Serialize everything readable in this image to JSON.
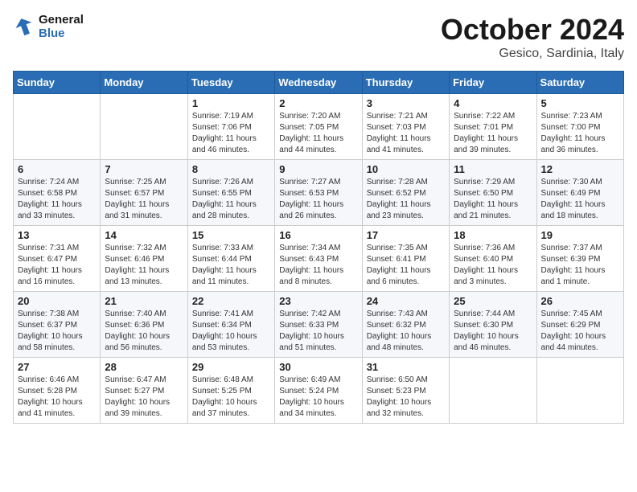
{
  "header": {
    "logo_line1": "General",
    "logo_line2": "Blue",
    "month": "October 2024",
    "location": "Gesico, Sardinia, Italy"
  },
  "weekdays": [
    "Sunday",
    "Monday",
    "Tuesday",
    "Wednesday",
    "Thursday",
    "Friday",
    "Saturday"
  ],
  "weeks": [
    [
      {
        "day": "",
        "info": ""
      },
      {
        "day": "",
        "info": ""
      },
      {
        "day": "1",
        "info": "Sunrise: 7:19 AM\nSunset: 7:06 PM\nDaylight: 11 hours and 46 minutes."
      },
      {
        "day": "2",
        "info": "Sunrise: 7:20 AM\nSunset: 7:05 PM\nDaylight: 11 hours and 44 minutes."
      },
      {
        "day": "3",
        "info": "Sunrise: 7:21 AM\nSunset: 7:03 PM\nDaylight: 11 hours and 41 minutes."
      },
      {
        "day": "4",
        "info": "Sunrise: 7:22 AM\nSunset: 7:01 PM\nDaylight: 11 hours and 39 minutes."
      },
      {
        "day": "5",
        "info": "Sunrise: 7:23 AM\nSunset: 7:00 PM\nDaylight: 11 hours and 36 minutes."
      }
    ],
    [
      {
        "day": "6",
        "info": "Sunrise: 7:24 AM\nSunset: 6:58 PM\nDaylight: 11 hours and 33 minutes."
      },
      {
        "day": "7",
        "info": "Sunrise: 7:25 AM\nSunset: 6:57 PM\nDaylight: 11 hours and 31 minutes."
      },
      {
        "day": "8",
        "info": "Sunrise: 7:26 AM\nSunset: 6:55 PM\nDaylight: 11 hours and 28 minutes."
      },
      {
        "day": "9",
        "info": "Sunrise: 7:27 AM\nSunset: 6:53 PM\nDaylight: 11 hours and 26 minutes."
      },
      {
        "day": "10",
        "info": "Sunrise: 7:28 AM\nSunset: 6:52 PM\nDaylight: 11 hours and 23 minutes."
      },
      {
        "day": "11",
        "info": "Sunrise: 7:29 AM\nSunset: 6:50 PM\nDaylight: 11 hours and 21 minutes."
      },
      {
        "day": "12",
        "info": "Sunrise: 7:30 AM\nSunset: 6:49 PM\nDaylight: 11 hours and 18 minutes."
      }
    ],
    [
      {
        "day": "13",
        "info": "Sunrise: 7:31 AM\nSunset: 6:47 PM\nDaylight: 11 hours and 16 minutes."
      },
      {
        "day": "14",
        "info": "Sunrise: 7:32 AM\nSunset: 6:46 PM\nDaylight: 11 hours and 13 minutes."
      },
      {
        "day": "15",
        "info": "Sunrise: 7:33 AM\nSunset: 6:44 PM\nDaylight: 11 hours and 11 minutes."
      },
      {
        "day": "16",
        "info": "Sunrise: 7:34 AM\nSunset: 6:43 PM\nDaylight: 11 hours and 8 minutes."
      },
      {
        "day": "17",
        "info": "Sunrise: 7:35 AM\nSunset: 6:41 PM\nDaylight: 11 hours and 6 minutes."
      },
      {
        "day": "18",
        "info": "Sunrise: 7:36 AM\nSunset: 6:40 PM\nDaylight: 11 hours and 3 minutes."
      },
      {
        "day": "19",
        "info": "Sunrise: 7:37 AM\nSunset: 6:39 PM\nDaylight: 11 hours and 1 minute."
      }
    ],
    [
      {
        "day": "20",
        "info": "Sunrise: 7:38 AM\nSunset: 6:37 PM\nDaylight: 10 hours and 58 minutes."
      },
      {
        "day": "21",
        "info": "Sunrise: 7:40 AM\nSunset: 6:36 PM\nDaylight: 10 hours and 56 minutes."
      },
      {
        "day": "22",
        "info": "Sunrise: 7:41 AM\nSunset: 6:34 PM\nDaylight: 10 hours and 53 minutes."
      },
      {
        "day": "23",
        "info": "Sunrise: 7:42 AM\nSunset: 6:33 PM\nDaylight: 10 hours and 51 minutes."
      },
      {
        "day": "24",
        "info": "Sunrise: 7:43 AM\nSunset: 6:32 PM\nDaylight: 10 hours and 48 minutes."
      },
      {
        "day": "25",
        "info": "Sunrise: 7:44 AM\nSunset: 6:30 PM\nDaylight: 10 hours and 46 minutes."
      },
      {
        "day": "26",
        "info": "Sunrise: 7:45 AM\nSunset: 6:29 PM\nDaylight: 10 hours and 44 minutes."
      }
    ],
    [
      {
        "day": "27",
        "info": "Sunrise: 6:46 AM\nSunset: 5:28 PM\nDaylight: 10 hours and 41 minutes."
      },
      {
        "day": "28",
        "info": "Sunrise: 6:47 AM\nSunset: 5:27 PM\nDaylight: 10 hours and 39 minutes."
      },
      {
        "day": "29",
        "info": "Sunrise: 6:48 AM\nSunset: 5:25 PM\nDaylight: 10 hours and 37 minutes."
      },
      {
        "day": "30",
        "info": "Sunrise: 6:49 AM\nSunset: 5:24 PM\nDaylight: 10 hours and 34 minutes."
      },
      {
        "day": "31",
        "info": "Sunrise: 6:50 AM\nSunset: 5:23 PM\nDaylight: 10 hours and 32 minutes."
      },
      {
        "day": "",
        "info": ""
      },
      {
        "day": "",
        "info": ""
      }
    ]
  ]
}
